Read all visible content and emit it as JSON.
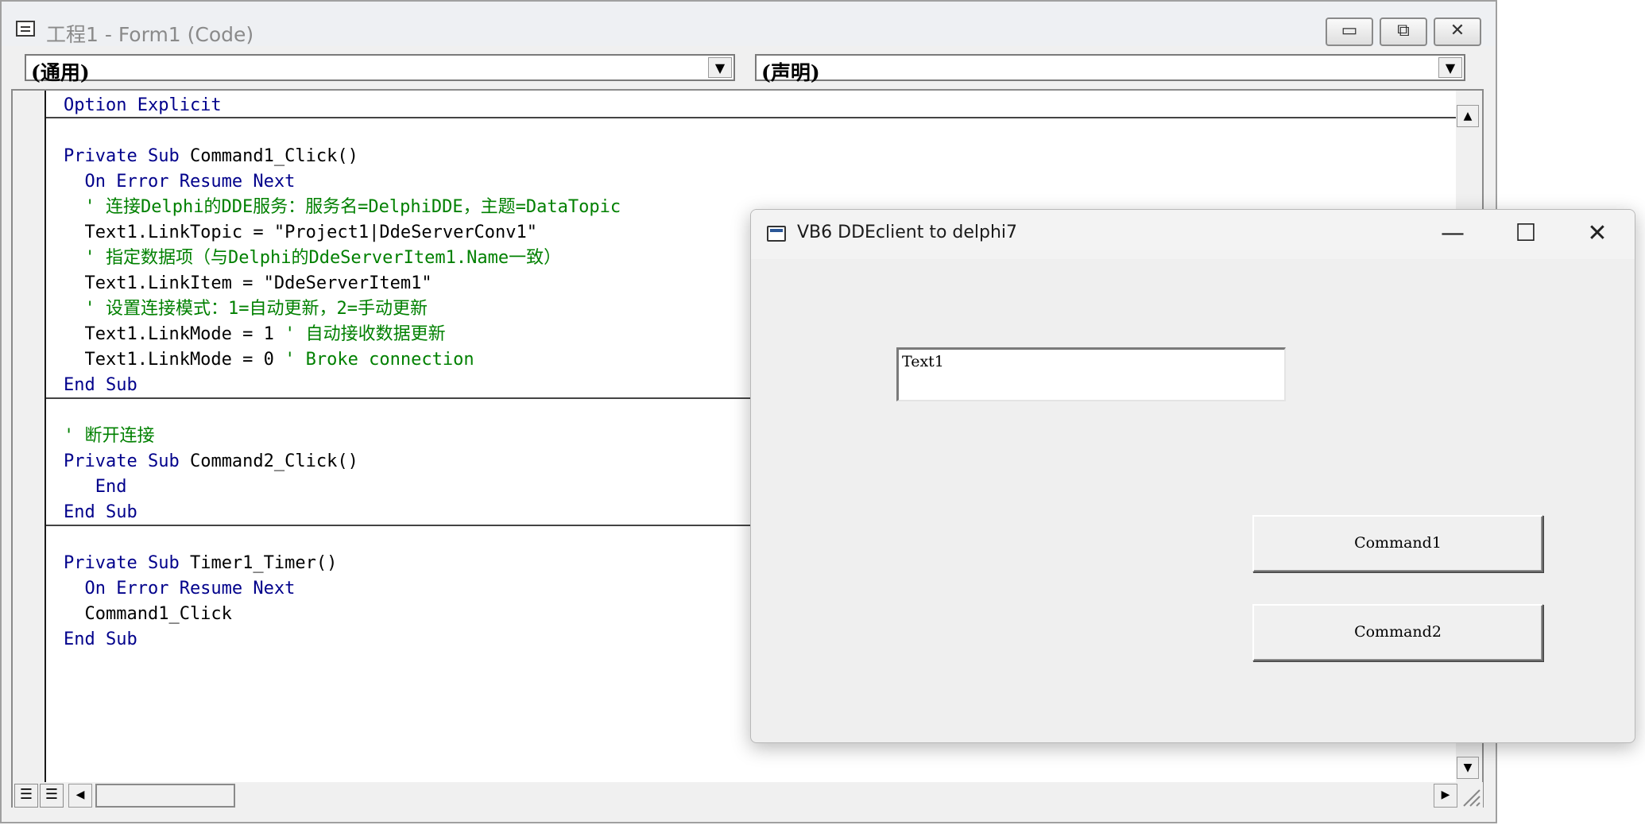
{
  "code_window": {
    "title": "工程1 - Form1 (Code)",
    "controls": {
      "minimize": "▭",
      "restore": "⧉",
      "close": "✕"
    },
    "object_combo": "(通用)",
    "procedure_combo": "(声明)",
    "lines": [
      {
        "segments": [
          {
            "t": "Option Explicit",
            "c": "kw"
          }
        ]
      },
      {
        "segments": []
      },
      {
        "segments": [
          {
            "t": "Private Sub ",
            "c": "kw"
          },
          {
            "t": "Command1_Click()",
            "c": ""
          }
        ]
      },
      {
        "segments": [
          {
            "t": "  On Error Resume Next",
            "c": "kw"
          }
        ]
      },
      {
        "segments": [
          {
            "t": "  ' 连接Delphi的DDE服务：服务名=DelphiDDE，主题=DataTopic",
            "c": "cm"
          }
        ]
      },
      {
        "segments": [
          {
            "t": "  Text1.LinkTopic = \"Project1|DdeServerConv1\"",
            "c": ""
          }
        ]
      },
      {
        "segments": [
          {
            "t": "  ' 指定数据项（与Delphi的DdeServerItem1.Name一致）",
            "c": "cm"
          }
        ]
      },
      {
        "segments": [
          {
            "t": "  Text1.LinkItem = \"DdeServerItem1\"",
            "c": ""
          }
        ]
      },
      {
        "segments": [
          {
            "t": "  ' 设置连接模式：1=自动更新，2=手动更新",
            "c": "cm"
          }
        ]
      },
      {
        "segments": [
          {
            "t": "  Text1.LinkMode = 1 ",
            "c": ""
          },
          {
            "t": "' 自动接收数据更新",
            "c": "cm"
          }
        ]
      },
      {
        "segments": [
          {
            "t": "  Text1.LinkMode = 0 ",
            "c": ""
          },
          {
            "t": "' Broke connection",
            "c": "cm"
          }
        ]
      },
      {
        "segments": [
          {
            "t": "End Sub",
            "c": "kw"
          }
        ]
      },
      {
        "segments": []
      },
      {
        "segments": [
          {
            "t": "' 断开连接",
            "c": "cm"
          }
        ]
      },
      {
        "segments": [
          {
            "t": "Private Sub ",
            "c": "kw"
          },
          {
            "t": "Command2_Click()",
            "c": ""
          }
        ]
      },
      {
        "segments": [
          {
            "t": "   End",
            "c": "kw"
          }
        ]
      },
      {
        "segments": [
          {
            "t": "End Sub",
            "c": "kw"
          }
        ]
      },
      {
        "segments": []
      },
      {
        "segments": [
          {
            "t": "Private Sub ",
            "c": "kw"
          },
          {
            "t": "Timer1_Timer()",
            "c": ""
          }
        ]
      },
      {
        "segments": [
          {
            "t": "  On Error Resume Next",
            "c": "kw"
          }
        ]
      },
      {
        "segments": [
          {
            "t": "  Command1_Click",
            "c": ""
          }
        ]
      },
      {
        "segments": [
          {
            "t": "End Sub",
            "c": "kw"
          }
        ]
      }
    ]
  },
  "form_window": {
    "title": "VB6 DDEclient to delphi7",
    "controls": {
      "minimize": "—",
      "maximize": "☐",
      "close": "✕"
    },
    "text1_value": "Text1",
    "command1_label": "Command1",
    "command2_label": "Command2"
  },
  "colors": {
    "keyword": "#00008b",
    "comment": "#008000",
    "text": "#000000"
  }
}
